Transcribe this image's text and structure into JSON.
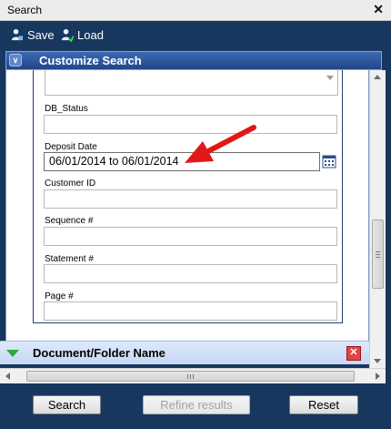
{
  "window": {
    "title": "Search"
  },
  "toolbar": {
    "save_label": "Save",
    "load_label": "Load"
  },
  "customize": {
    "label": "Customize Search"
  },
  "fields": [
    {
      "label": "DB_Status",
      "value": ""
    },
    {
      "label": "Deposit Date",
      "value": "06/01/2014 to 06/01/2014"
    },
    {
      "label": "Customer ID",
      "value": ""
    },
    {
      "label": "Sequence #",
      "value": ""
    },
    {
      "label": "Statement #",
      "value": ""
    },
    {
      "label": "Page #",
      "value": ""
    }
  ],
  "section": {
    "label": "Document/Folder Name"
  },
  "footer": {
    "search_label": "Search",
    "refine_label": "Refine results",
    "reset_label": "Reset"
  },
  "colors": {
    "accent": "#17375e",
    "annotation_arrow": "#e0181a"
  }
}
